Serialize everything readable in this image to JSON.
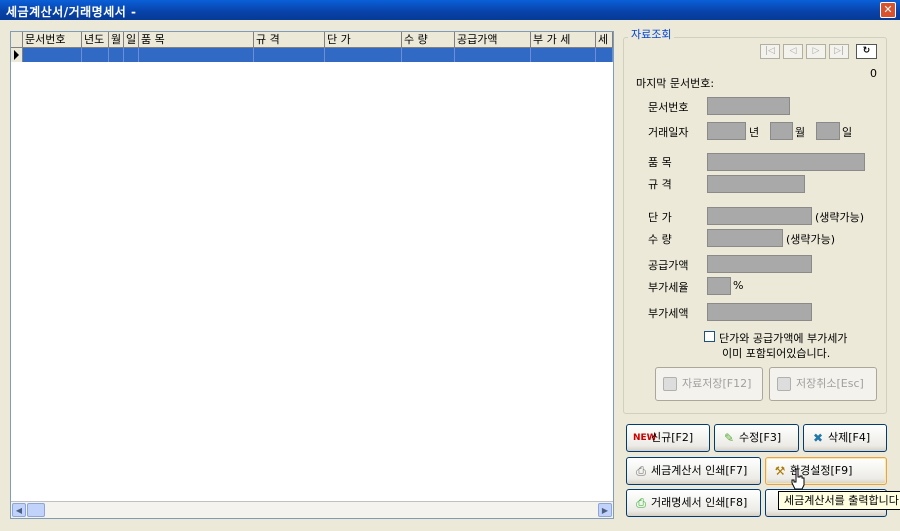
{
  "window": {
    "title": "세금계산서/거래명세서 -",
    "close_glyph": "✕"
  },
  "grid": {
    "columns": [
      "문서번호",
      "년도",
      "월",
      "일",
      "품 목",
      "규 격",
      "단 가",
      "수 량",
      "공급가액",
      "부 가 세",
      "세"
    ]
  },
  "panel": {
    "legend": "자료조회",
    "nav": {
      "first": "|◁",
      "prev": "◁",
      "next": "▷",
      "last": "▷|",
      "refresh": "↻"
    },
    "count": "0",
    "last_doc_label": "마지막 문서번호:",
    "labels": {
      "doc_no": "문서번호",
      "trade_date": "거래일자",
      "year_suffix": "년",
      "month_suffix": "월",
      "day_suffix": "일",
      "item": "품      목",
      "spec": "규      격",
      "unit_price": "단      가",
      "optional_1": "(생략가능)",
      "qty": "수      량",
      "optional_2": "(생략가능)",
      "supply": "공급가액",
      "vat_rate": "부가세율",
      "pct": "%",
      "vat": "부가세액"
    },
    "checkbox_line1": "단가와 공급가액에 부가세가",
    "checkbox_line2": "이미 포함되어있습니다.",
    "save_button": "자료저장[F12]",
    "cancel_button": "저장취소[Esc]"
  },
  "actions": {
    "new": "신규[F2]",
    "edit": "수정[F3]",
    "delete": "삭제[F4]",
    "print_invoice": "세금계산서 인쇄[F7]",
    "settings": "환경설정[F9]",
    "print_statement": "거래명세서 인쇄[F8]"
  },
  "tooltip": "세금계산서를 출력합니다"
}
